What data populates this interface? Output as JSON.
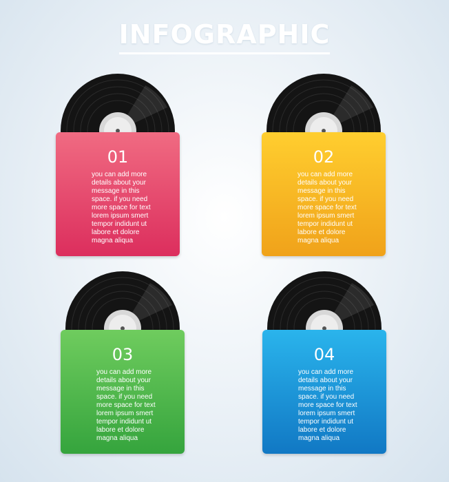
{
  "title": "INFOGRAPHIC",
  "colors": {
    "pink": [
      "#f06b82",
      "#dc2e5d"
    ],
    "orange": [
      "#ffce2f",
      "#f0a21a"
    ],
    "green": [
      "#6fcc5e",
      "#35a43d"
    ],
    "blue": [
      "#2ab4ec",
      "#1178c4"
    ]
  },
  "items": [
    {
      "number": "01",
      "text": "you can add more\ndetails about your\nmessage in this\nspace. if you need\nmore space for text\nlorem ipsum smert\ntempor indidunt ut\nlabore et dolore\nmagna aliqua"
    },
    {
      "number": "02",
      "text": "you can add more\ndetails about your\nmessage in this\nspace. if you need\nmore space for text\nlorem ipsum smert\ntempor indidunt ut\nlabore et dolore\nmagna aliqua"
    },
    {
      "number": "03",
      "text": "you can add more\ndetails about your\nmessage in this\nspace. if you need\nmore space for text\nlorem ipsum smert\ntempor indidunt ut\nlabore et dolore\nmagna aliqua"
    },
    {
      "number": "04",
      "text": "you can add more\ndetails about your\nmessage in this\nspace. if you need\nmore space for text\nlorem ipsum smert\ntempor indidunt ut\nlabore et dolore\nmagna aliqua"
    }
  ]
}
